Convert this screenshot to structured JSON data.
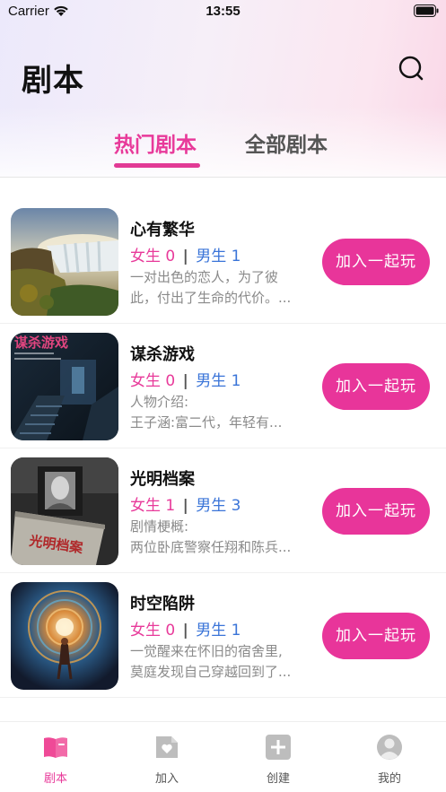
{
  "status_bar": {
    "carrier": "Carrier",
    "time": "13:55"
  },
  "header": {
    "title": "剧本",
    "search_icon": "search-icon"
  },
  "tabs": [
    {
      "label": "热门剧本",
      "active": true
    },
    {
      "label": "全部剧本",
      "active": false
    }
  ],
  "scripts": [
    {
      "title": "心有繁华",
      "female_label": "女生",
      "female_count": "0",
      "male_label": "男生",
      "male_count": "1",
      "desc": [
        "一对出色的恋人，为了彼",
        "此，付出了生命的代价。..."
      ],
      "button": "加入一起玩"
    },
    {
      "title": "谋杀游戏",
      "female_label": "女生",
      "female_count": "0",
      "male_label": "男生",
      "male_count": "1",
      "desc": [
        "人物介绍:",
        "王子涵:富二代，年轻有..."
      ],
      "button": "加入一起玩",
      "cover_text": "谋杀游戏"
    },
    {
      "title": "光明档案",
      "female_label": "女生",
      "female_count": "1",
      "male_label": "男生",
      "male_count": "3",
      "desc": [
        "剧情梗概:",
        "两位卧底警察任翔和陈兵..."
      ],
      "button": "加入一起玩",
      "cover_text": "光明档案"
    },
    {
      "title": "时空陷阱",
      "female_label": "女生",
      "female_count": "0",
      "male_label": "男生",
      "male_count": "1",
      "desc": [
        "一觉醒来在怀旧的宿舍里,",
        "莫庭发现自己穿越回到了..."
      ],
      "button": "加入一起玩"
    }
  ],
  "tabbar": [
    {
      "label": "剧本",
      "icon": "book-icon",
      "active": true
    },
    {
      "label": "加入",
      "icon": "heart-doc-icon",
      "active": false
    },
    {
      "label": "创建",
      "icon": "plus-icon",
      "active": false
    },
    {
      "label": "我的",
      "icon": "user-icon",
      "active": false
    }
  ],
  "colors": {
    "accent": "#e8359a",
    "male": "#3a74d8",
    "muted": "#8a8a8a"
  }
}
